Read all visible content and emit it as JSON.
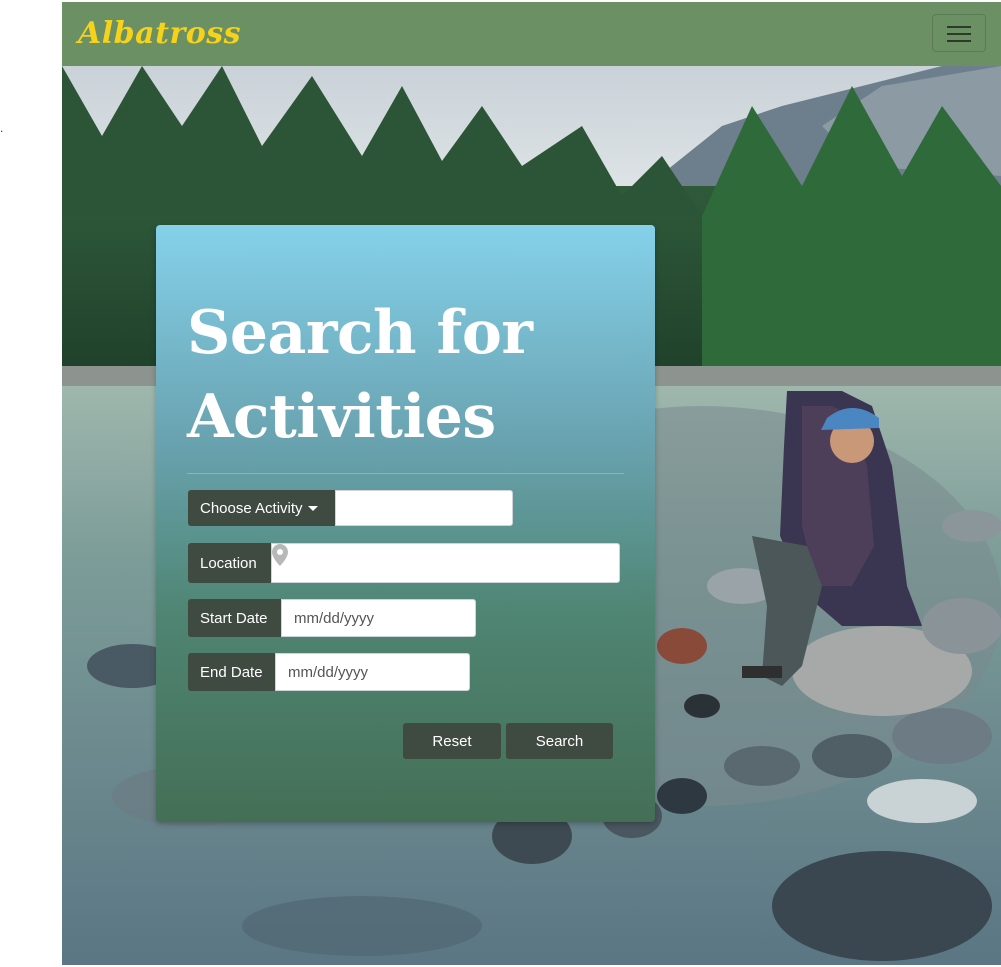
{
  "page": {
    "stray_mark": "."
  },
  "navbar": {
    "brand": "Albatross",
    "menu_icon": "hamburger-icon",
    "background": "#6b9064",
    "brand_color": "#f6d21b"
  },
  "search_panel": {
    "title_line1": "Search for",
    "title_line2": "Activities",
    "activity": {
      "label": "Choose Activity",
      "value": ""
    },
    "location": {
      "label": "Location",
      "value": "",
      "icon": "map-pin-icon"
    },
    "start_date": {
      "label": "Start Date",
      "placeholder": "mm/dd/yyyy"
    },
    "end_date": {
      "label": "End Date",
      "placeholder": "mm/dd/yyyy"
    },
    "reset_label": "Reset",
    "search_label": "Search",
    "button_color": "#3f4a41"
  }
}
